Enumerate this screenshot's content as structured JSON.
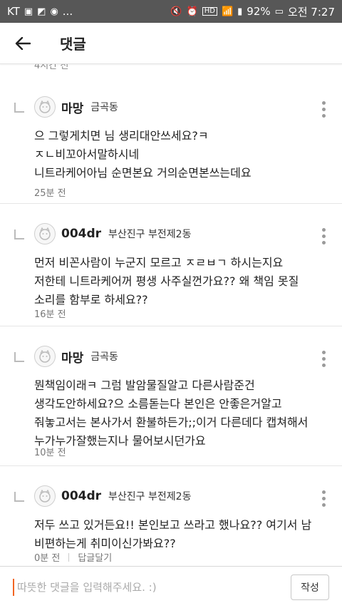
{
  "statusbar": {
    "carrier": "KT",
    "dots": "...",
    "battery": "92%",
    "time": "오전 7:27"
  },
  "header": {
    "title": "댓글"
  },
  "previous": {
    "time": "4시간 전"
  },
  "comments": [
    {
      "nickname": "마망",
      "location": "금곡동",
      "lines": [
        "으 그렇게치면 님 생리대안쓰세요?ㅋ",
        "ㅈㄴ비꼬아서말하시네",
        "니트라케어아님 순면본요 거의순면본쓰는데요"
      ],
      "time": "25분 전"
    },
    {
      "nickname": "004dr",
      "location": "부산진구 부전제2동",
      "lines": [
        "먼저 비꼰사람이 누군지 모르고 ㅈㄹㅂㄱ 하시는지요",
        "저한테 니트라케어꺼 평생 사주실껀가요?? 왜 책임 못질",
        "소리를 함부로 하세요??"
      ],
      "time": "16분 전"
    },
    {
      "nickname": "마망",
      "location": "금곡동",
      "lines": [
        "뭔책임이래ㅋ 그럼 발암물질알고 다른사람준건",
        "생각도안하세요?으 소름돋는다 본인은 안좋은거알고",
        "줘놓고서는 본사가서 환불하든가;;이거 다른데다 캡쳐해서",
        "누가누가잘했는지나 물어보시던가요"
      ],
      "time": "10분 전"
    },
    {
      "nickname": "004dr",
      "location": "부산진구 부전제2동",
      "lines": [
        "저두 쓰고 있거든요!! 본인보고 쓰라고 했나요?? 여기서 남",
        "비편하는게 취미이신가봐요??"
      ],
      "time": "0분 전",
      "reply": "답글달기"
    }
  ],
  "composer": {
    "placeholder": "따뜻한 댓글을 입력해주세요. :)",
    "submit": "작성"
  }
}
